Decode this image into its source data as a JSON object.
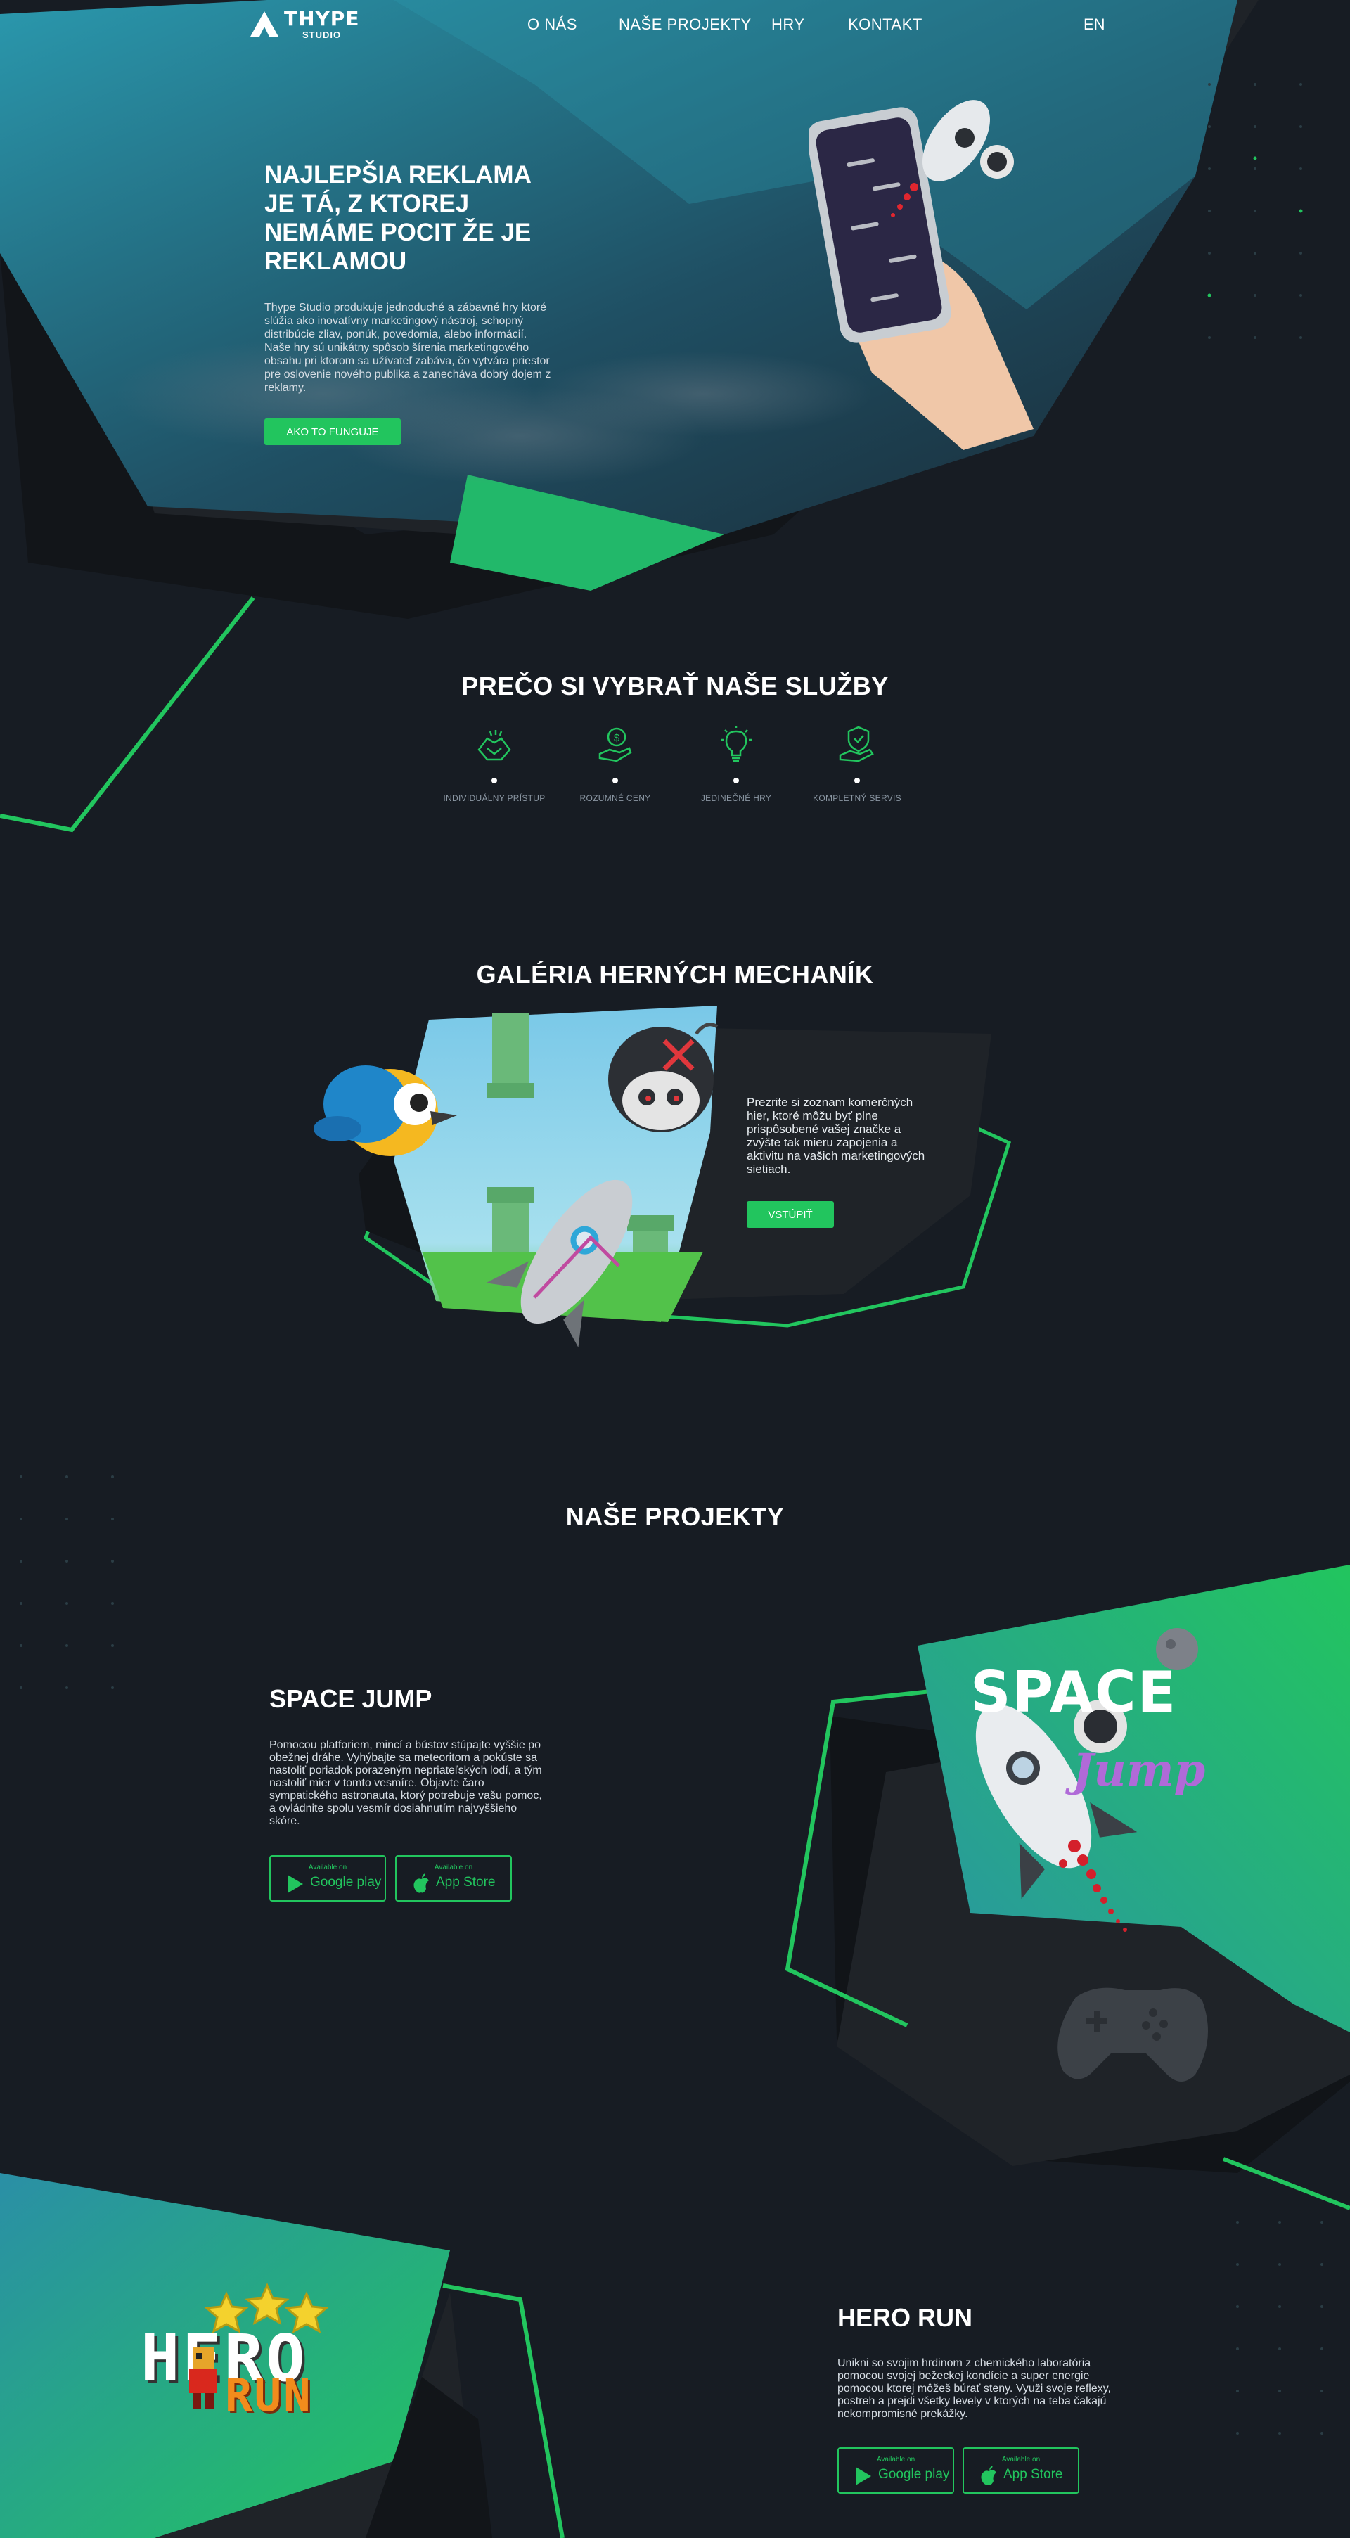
{
  "nav": {
    "logo_main": "THYPE",
    "logo_sub": "STUDIO",
    "items": [
      "O NÁS",
      "NAŠE PROJEKTY",
      "HRY",
      "KONTAKT"
    ],
    "lang": "EN"
  },
  "hero": {
    "title": "NAJLEPŠIA REKLAMA JE TÁ, Z KTOREJ NEMÁME POCIT ŽE JE REKLAMOU",
    "text": "Thype Studio produkuje jednoduché a zábavné hry ktoré slúžia ako inovatívny marketingový nástroj, schopný distribúcie zliav, ponúk, povedomia, alebo informácií. Naše hry sú unikátny spôsob šírenia marketingového obsahu pri ktorom sa užívateľ zabáva, čo vytvára priestor pre oslovenie nového publika a zanecháva dobrý dojem z reklamy.",
    "button": "AKO TO FUNGUJE"
  },
  "why": {
    "title": "PREČO SI VYBRAŤ NAŠE SLUŽBY",
    "features": [
      {
        "label": "INDIVIDUÁLNY PRÍSTUP",
        "icon": "handshake-icon"
      },
      {
        "label": "ROZUMNÉ CENY",
        "icon": "money-hand-icon"
      },
      {
        "label": "JEDINEČNÉ HRY",
        "icon": "lightbulb-icon"
      },
      {
        "label": "KOMPLETNÝ SERVIS",
        "icon": "shield-hand-icon"
      }
    ]
  },
  "gallery": {
    "title": "GALÉRIA HERNÝCH MECHANÍK",
    "text": "Prezrite si zoznam komerčných hier, ktoré môžu byť plne prispôsobené vašej značke a zvýšte tak mieru zapojenia a aktivitu na vašich marketingových sietiach.",
    "button": "VSTÚPIŤ"
  },
  "projects": {
    "title": "NAŠE PROJEKTY",
    "items": [
      {
        "title": "SPACE JUMP",
        "text": "Pomocou platforiem, mincí a bústov stúpajte vyššie po obežnej dráhe. Vyhýbajte sa meteoritom a pokúste sa nastoliť poriadok porazeným nepriateľských lodí, a tým nastoliť mier v tomto vesmíre. Objavte čaro sympatického astronauta, ktorý potrebuje vašu pomoc, a ovládnite spolu vesmír dosiahnutím najvyššieho skóre.",
        "logo_line1": "SPACE",
        "logo_line2": "Jump"
      },
      {
        "title": "HERO RUN",
        "text": "Unikni so svojim hrdinom z chemického laboratória pomocou svojej bežeckej kondície a super energie pomocou ktorej môžeš búrať steny. Využi svoje reflexy, postreh a prejdi všetky levely v ktorých na teba čakajú nekompromisné prekážky.",
        "logo_line1": "HERO",
        "logo_line2": "RUN"
      }
    ],
    "store": {
      "available": "Available on",
      "google": "Google play",
      "apple": "App Store"
    }
  },
  "colors": {
    "background": "#171c23",
    "accent": "#22c55e",
    "teal": "#2b93a8"
  }
}
